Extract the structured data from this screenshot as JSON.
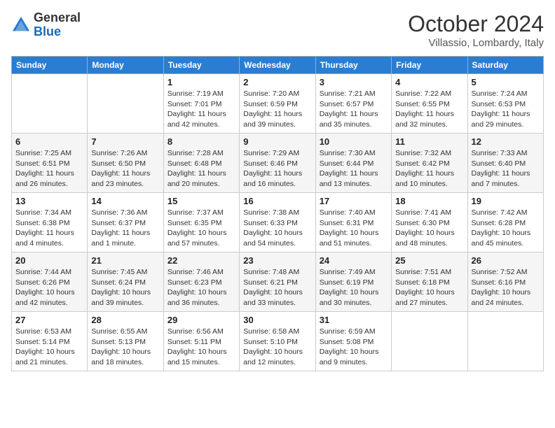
{
  "header": {
    "logo_general": "General",
    "logo_blue": "Blue",
    "month": "October 2024",
    "location": "Villassio, Lombardy, Italy"
  },
  "weekdays": [
    "Sunday",
    "Monday",
    "Tuesday",
    "Wednesday",
    "Thursday",
    "Friday",
    "Saturday"
  ],
  "weeks": [
    [
      {
        "day": "",
        "sunrise": "",
        "sunset": "",
        "daylight": ""
      },
      {
        "day": "",
        "sunrise": "",
        "sunset": "",
        "daylight": ""
      },
      {
        "day": "1",
        "sunrise": "Sunrise: 7:19 AM",
        "sunset": "Sunset: 7:01 PM",
        "daylight": "Daylight: 11 hours and 42 minutes."
      },
      {
        "day": "2",
        "sunrise": "Sunrise: 7:20 AM",
        "sunset": "Sunset: 6:59 PM",
        "daylight": "Daylight: 11 hours and 39 minutes."
      },
      {
        "day": "3",
        "sunrise": "Sunrise: 7:21 AM",
        "sunset": "Sunset: 6:57 PM",
        "daylight": "Daylight: 11 hours and 35 minutes."
      },
      {
        "day": "4",
        "sunrise": "Sunrise: 7:22 AM",
        "sunset": "Sunset: 6:55 PM",
        "daylight": "Daylight: 11 hours and 32 minutes."
      },
      {
        "day": "5",
        "sunrise": "Sunrise: 7:24 AM",
        "sunset": "Sunset: 6:53 PM",
        "daylight": "Daylight: 11 hours and 29 minutes."
      }
    ],
    [
      {
        "day": "6",
        "sunrise": "Sunrise: 7:25 AM",
        "sunset": "Sunset: 6:51 PM",
        "daylight": "Daylight: 11 hours and 26 minutes."
      },
      {
        "day": "7",
        "sunrise": "Sunrise: 7:26 AM",
        "sunset": "Sunset: 6:50 PM",
        "daylight": "Daylight: 11 hours and 23 minutes."
      },
      {
        "day": "8",
        "sunrise": "Sunrise: 7:28 AM",
        "sunset": "Sunset: 6:48 PM",
        "daylight": "Daylight: 11 hours and 20 minutes."
      },
      {
        "day": "9",
        "sunrise": "Sunrise: 7:29 AM",
        "sunset": "Sunset: 6:46 PM",
        "daylight": "Daylight: 11 hours and 16 minutes."
      },
      {
        "day": "10",
        "sunrise": "Sunrise: 7:30 AM",
        "sunset": "Sunset: 6:44 PM",
        "daylight": "Daylight: 11 hours and 13 minutes."
      },
      {
        "day": "11",
        "sunrise": "Sunrise: 7:32 AM",
        "sunset": "Sunset: 6:42 PM",
        "daylight": "Daylight: 11 hours and 10 minutes."
      },
      {
        "day": "12",
        "sunrise": "Sunrise: 7:33 AM",
        "sunset": "Sunset: 6:40 PM",
        "daylight": "Daylight: 11 hours and 7 minutes."
      }
    ],
    [
      {
        "day": "13",
        "sunrise": "Sunrise: 7:34 AM",
        "sunset": "Sunset: 6:38 PM",
        "daylight": "Daylight: 11 hours and 4 minutes."
      },
      {
        "day": "14",
        "sunrise": "Sunrise: 7:36 AM",
        "sunset": "Sunset: 6:37 PM",
        "daylight": "Daylight: 11 hours and 1 minute."
      },
      {
        "day": "15",
        "sunrise": "Sunrise: 7:37 AM",
        "sunset": "Sunset: 6:35 PM",
        "daylight": "Daylight: 10 hours and 57 minutes."
      },
      {
        "day": "16",
        "sunrise": "Sunrise: 7:38 AM",
        "sunset": "Sunset: 6:33 PM",
        "daylight": "Daylight: 10 hours and 54 minutes."
      },
      {
        "day": "17",
        "sunrise": "Sunrise: 7:40 AM",
        "sunset": "Sunset: 6:31 PM",
        "daylight": "Daylight: 10 hours and 51 minutes."
      },
      {
        "day": "18",
        "sunrise": "Sunrise: 7:41 AM",
        "sunset": "Sunset: 6:30 PM",
        "daylight": "Daylight: 10 hours and 48 minutes."
      },
      {
        "day": "19",
        "sunrise": "Sunrise: 7:42 AM",
        "sunset": "Sunset: 6:28 PM",
        "daylight": "Daylight: 10 hours and 45 minutes."
      }
    ],
    [
      {
        "day": "20",
        "sunrise": "Sunrise: 7:44 AM",
        "sunset": "Sunset: 6:26 PM",
        "daylight": "Daylight: 10 hours and 42 minutes."
      },
      {
        "day": "21",
        "sunrise": "Sunrise: 7:45 AM",
        "sunset": "Sunset: 6:24 PM",
        "daylight": "Daylight: 10 hours and 39 minutes."
      },
      {
        "day": "22",
        "sunrise": "Sunrise: 7:46 AM",
        "sunset": "Sunset: 6:23 PM",
        "daylight": "Daylight: 10 hours and 36 minutes."
      },
      {
        "day": "23",
        "sunrise": "Sunrise: 7:48 AM",
        "sunset": "Sunset: 6:21 PM",
        "daylight": "Daylight: 10 hours and 33 minutes."
      },
      {
        "day": "24",
        "sunrise": "Sunrise: 7:49 AM",
        "sunset": "Sunset: 6:19 PM",
        "daylight": "Daylight: 10 hours and 30 minutes."
      },
      {
        "day": "25",
        "sunrise": "Sunrise: 7:51 AM",
        "sunset": "Sunset: 6:18 PM",
        "daylight": "Daylight: 10 hours and 27 minutes."
      },
      {
        "day": "26",
        "sunrise": "Sunrise: 7:52 AM",
        "sunset": "Sunset: 6:16 PM",
        "daylight": "Daylight: 10 hours and 24 minutes."
      }
    ],
    [
      {
        "day": "27",
        "sunrise": "Sunrise: 6:53 AM",
        "sunset": "Sunset: 5:14 PM",
        "daylight": "Daylight: 10 hours and 21 minutes."
      },
      {
        "day": "28",
        "sunrise": "Sunrise: 6:55 AM",
        "sunset": "Sunset: 5:13 PM",
        "daylight": "Daylight: 10 hours and 18 minutes."
      },
      {
        "day": "29",
        "sunrise": "Sunrise: 6:56 AM",
        "sunset": "Sunset: 5:11 PM",
        "daylight": "Daylight: 10 hours and 15 minutes."
      },
      {
        "day": "30",
        "sunrise": "Sunrise: 6:58 AM",
        "sunset": "Sunset: 5:10 PM",
        "daylight": "Daylight: 10 hours and 12 minutes."
      },
      {
        "day": "31",
        "sunrise": "Sunrise: 6:59 AM",
        "sunset": "Sunset: 5:08 PM",
        "daylight": "Daylight: 10 hours and 9 minutes."
      },
      {
        "day": "",
        "sunrise": "",
        "sunset": "",
        "daylight": ""
      },
      {
        "day": "",
        "sunrise": "",
        "sunset": "",
        "daylight": ""
      }
    ]
  ]
}
